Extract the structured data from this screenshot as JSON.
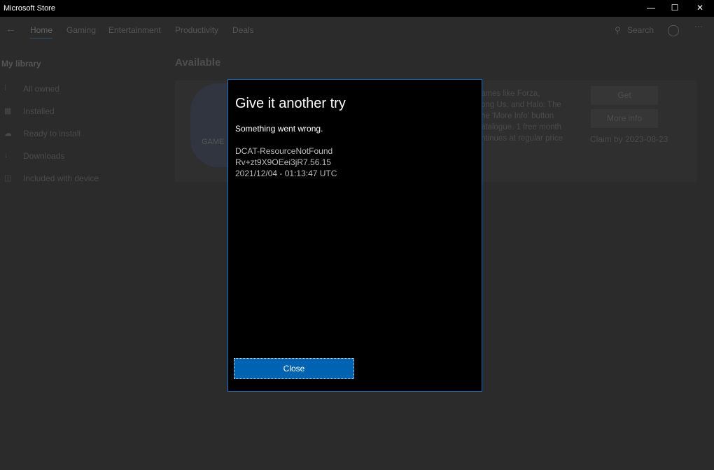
{
  "window": {
    "title": "Microsoft Store",
    "controls": [
      "minimize",
      "maximize",
      "close"
    ]
  },
  "nav": {
    "tabs": [
      "Home",
      "Gaming",
      "Entertainment",
      "Productivity",
      "Deals"
    ],
    "active": "Home",
    "search_label": "Search"
  },
  "sidebar": {
    "heading": "My library",
    "items": [
      {
        "label": "All owned",
        "icon": "grid-icon"
      },
      {
        "label": "Installed",
        "icon": "installed-icon"
      },
      {
        "label": "Ready to install",
        "icon": "cloud-download-icon"
      },
      {
        "label": "Downloads",
        "icon": "download-icon"
      },
      {
        "label": "Included with device",
        "icon": "gift-icon"
      }
    ]
  },
  "main": {
    "heading": "Available",
    "card": {
      "image_text": "GAME",
      "description": [
        "ames like Forza,",
        "ong Us, and Halo: The",
        "he 'More Info' button",
        "atalogue. 1 free month",
        "ntinues at regular price"
      ],
      "get_label": "Get",
      "more_info_label": "More info",
      "claim": "Claim by 2023-08-23"
    }
  },
  "dialog": {
    "title": "Give it another try",
    "subtitle": "Something went wrong.",
    "details": [
      "DCAT-ResourceNotFound",
      "Rv+zt9X9OEei3jR7.56.15",
      "2021/12/04 - 01:13:47 UTC"
    ],
    "close_label": "Close",
    "accent": "#0063b1"
  }
}
